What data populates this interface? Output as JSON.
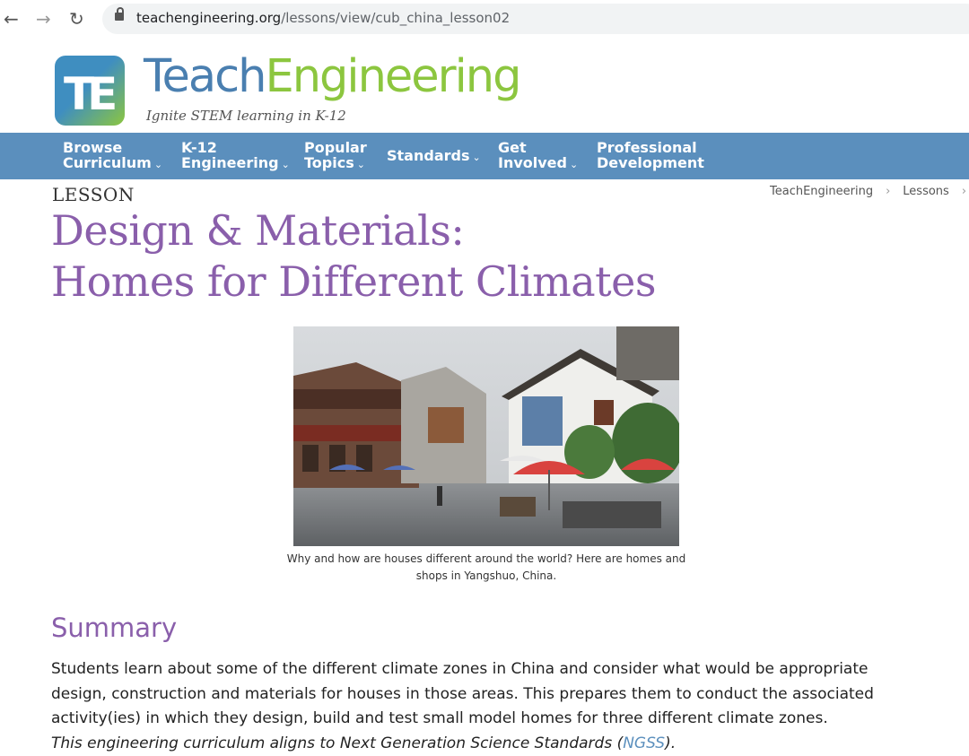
{
  "browser": {
    "url_domain": "teachengineering.org",
    "url_path": "/lessons/view/cub_china_lesson02"
  },
  "brand": {
    "name_part1": "Teach",
    "name_part2": "Engineering",
    "tagline": "Ignite STEM learning in K-12",
    "logo_text": "TE",
    "colors": {
      "blue": "#4a7fb0",
      "green": "#8cc63f",
      "purple": "#8a5fab",
      "nav": "#5b8fbd"
    }
  },
  "nav": [
    {
      "line1": "Browse",
      "line2": "Curriculum",
      "dropdown": true
    },
    {
      "line1": "K-12",
      "line2": "Engineering",
      "dropdown": true
    },
    {
      "line1": "Popular",
      "line2": "Topics",
      "dropdown": true
    },
    {
      "line1": "Standards",
      "line2": "",
      "dropdown": true
    },
    {
      "line1": "Get",
      "line2": "Involved",
      "dropdown": true
    },
    {
      "line1": "Professional",
      "line2": "Development",
      "dropdown": false
    }
  ],
  "breadcrumb": [
    "TeachEngineering",
    "Lessons"
  ],
  "page": {
    "eyebrow": "LESSON",
    "title_line1": "Design & Materials:",
    "title_line2": "Homes for Different Climates"
  },
  "photo": {
    "caption_line1": "Why and how are houses different around the world? Here are homes and",
    "caption_line2": "shops in Yangshuo, China."
  },
  "summary": {
    "heading": "Summary",
    "line1": "Students learn about some of the different climate zones in China and consider what would be appropriate",
    "line2": "design, construction and materials for houses in those areas. This prepares them to conduct the associated",
    "line3": "activity(ies) in which they design, build and test small model homes for three different climate zones.",
    "ngss_prefix": "This engineering curriculum aligns to Next Generation Science Standards (",
    "ngss_link": "NGSS",
    "ngss_suffix": ")."
  }
}
